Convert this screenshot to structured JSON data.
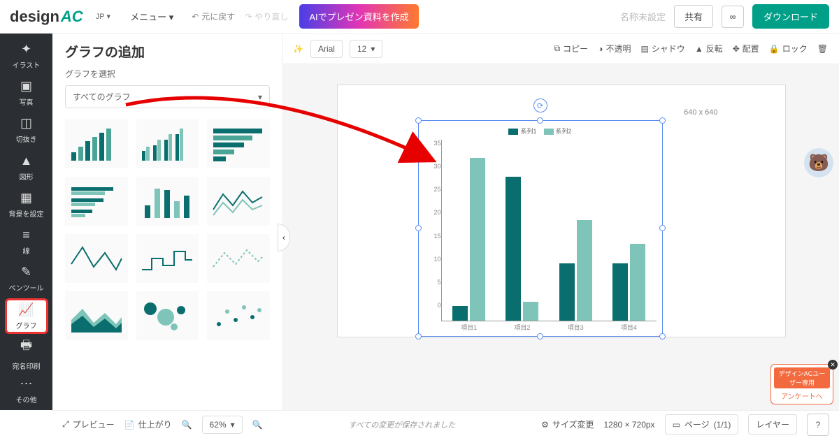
{
  "brand": {
    "name": "design",
    "suffix": "AC"
  },
  "lang": "JP",
  "menu": "メニュー",
  "undo": "元に戻す",
  "redo": "やり直し",
  "ai_btn": "AIでプレゼン資料を作成",
  "title_ph": "名称未設定",
  "share": "共有",
  "download": "ダウンロード",
  "rail": [
    "イラスト",
    "写真",
    "切抜き",
    "図形",
    "背景を設定",
    "線",
    "ペンツール",
    "グラフ",
    "宛名印刷",
    "その他"
  ],
  "panel": {
    "title": "グラフの追加",
    "sub": "グラフを選択",
    "dropdown": "すべてのグラフ"
  },
  "props": {
    "font": "Arial",
    "size": "12",
    "copy": "コピー",
    "opacity": "不透明",
    "shadow": "シャドウ",
    "flip": "反転",
    "align": "配置",
    "lock": "ロック"
  },
  "canvas": {
    "dim": "640 x 640"
  },
  "chart_data": {
    "type": "bar",
    "series": [
      {
        "name": "系列1",
        "color": "#0a6e6e",
        "values": [
          3,
          30,
          12,
          12
        ]
      },
      {
        "name": "系列2",
        "color": "#7fc4b8",
        "values": [
          34,
          4,
          21,
          16
        ]
      }
    ],
    "categories": [
      "項目1",
      "項目2",
      "項目3",
      "項目4"
    ],
    "ylim": [
      0,
      35
    ],
    "yticks": [
      0,
      5,
      10,
      15,
      20,
      25,
      30,
      35
    ]
  },
  "bottom": {
    "preview": "プレビュー",
    "finish": "仕上がり",
    "zoom": "62%",
    "status": "すべての変更が保存されました",
    "resize": "サイズ変更",
    "dims": "1280 × 720px",
    "page": "ページ",
    "page_no": "(1/1)",
    "layer": "レイヤー"
  },
  "survey": {
    "hd": "デザインACユーザー専用",
    "btn": "アンケートへ"
  }
}
